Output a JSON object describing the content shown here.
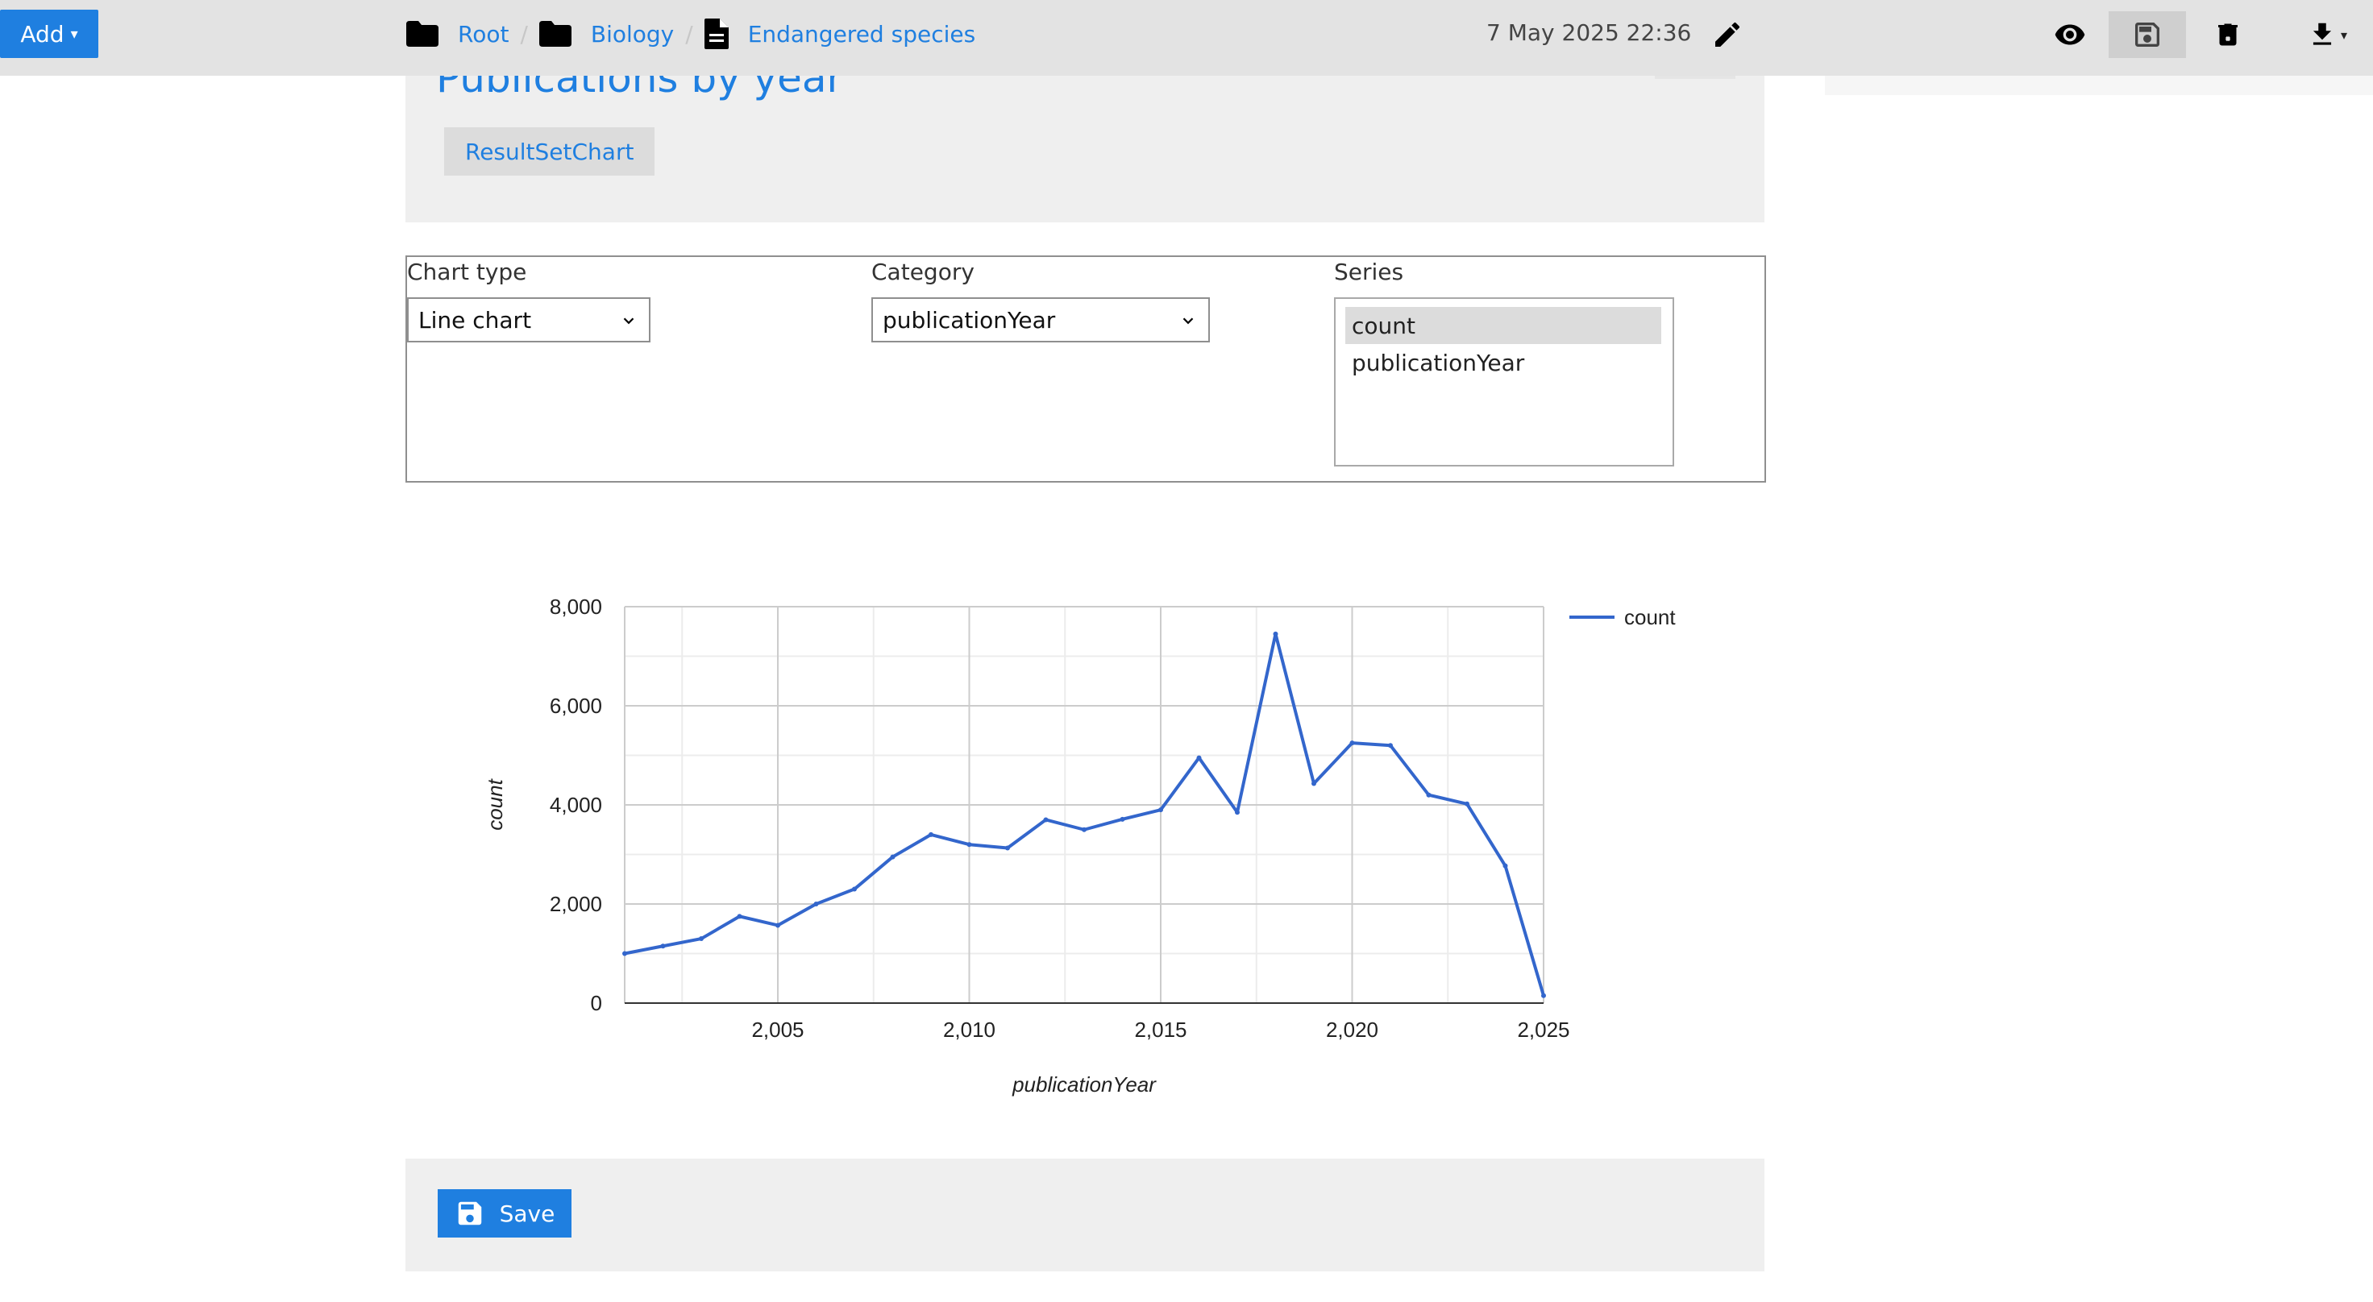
{
  "toolbar": {
    "add_label": "Add",
    "breadcrumbs": [
      {
        "label": "Root",
        "icon": "folder-icon"
      },
      {
        "label": "Biology",
        "icon": "folder-icon"
      },
      {
        "label": "Endangered species",
        "icon": "document-icon"
      }
    ],
    "separator": "/",
    "timestamp": "7 May 2025 22:36",
    "icons": [
      "edit-icon",
      "view-icon",
      "save-icon",
      "delete-icon",
      "download-icon"
    ]
  },
  "header": {
    "title": "Publications by year",
    "tag": "ResultSetChart"
  },
  "controls": {
    "chart_type_label": "Chart type",
    "chart_type_value": "Line chart",
    "category_label": "Category",
    "category_value": "publicationYear",
    "series_label": "Series",
    "series_options": [
      {
        "label": "count",
        "selected": true
      },
      {
        "label": "publicationYear",
        "selected": false
      }
    ]
  },
  "chart_data": {
    "type": "line",
    "xlabel": "publicationYear",
    "ylabel": "count",
    "xlim": [
      2001,
      2025
    ],
    "ylim": [
      0,
      8000
    ],
    "x_ticks": [
      "2,005",
      "2,010",
      "2,015",
      "2,020",
      "2,025"
    ],
    "y_ticks": [
      "0",
      "2,000",
      "4,000",
      "6,000",
      "8,000"
    ],
    "legend_position": "top-right",
    "grid": true,
    "series": [
      {
        "name": "count",
        "color": "#3366cc",
        "x": [
          2001,
          2002,
          2003,
          2004,
          2005,
          2006,
          2007,
          2008,
          2009,
          2010,
          2011,
          2012,
          2013,
          2014,
          2015,
          2016,
          2017,
          2018,
          2019,
          2020,
          2021,
          2022,
          2023,
          2024,
          2025
        ],
        "y": [
          1000,
          1150,
          1300,
          1750,
          1570,
          2000,
          2300,
          2950,
          3400,
          3200,
          3130,
          3700,
          3500,
          3710,
          3900,
          4950,
          3850,
          7450,
          4430,
          5250,
          5200,
          4200,
          4020,
          2770,
          150
        ]
      }
    ]
  },
  "footer": {
    "save_label": "Save"
  },
  "colors": {
    "accent": "#1f7fe0",
    "toolbar_bg": "#e3e3e3",
    "panel_bg": "#efefef",
    "series": "#3366cc"
  }
}
